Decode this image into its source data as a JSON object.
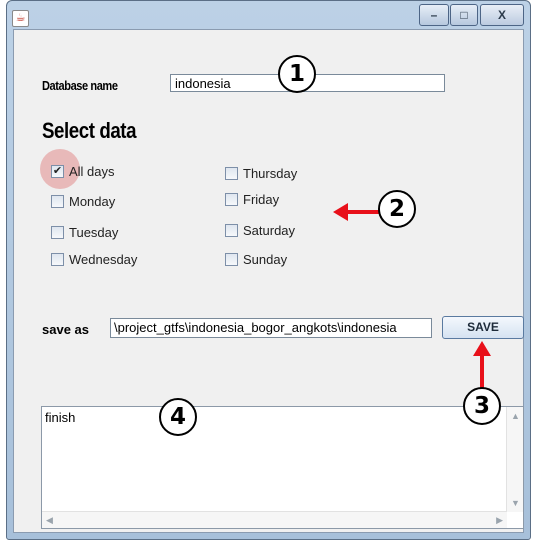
{
  "window": {
    "app_icon": "java-icon",
    "buttons": {
      "minimize": "–",
      "maximize": "□",
      "close": "X"
    }
  },
  "form": {
    "database_label": "Database name",
    "database_value": "indonesia",
    "select_title": "Select data",
    "days": [
      {
        "label": "All days",
        "checked": true
      },
      {
        "label": "Monday",
        "checked": false
      },
      {
        "label": "Tuesday",
        "checked": false
      },
      {
        "label": "Wednesday",
        "checked": false
      },
      {
        "label": "Thursday",
        "checked": false
      },
      {
        "label": "Friday",
        "checked": false
      },
      {
        "label": "Saturday",
        "checked": false
      },
      {
        "label": "Sunday",
        "checked": false
      }
    ],
    "save_label": "save as",
    "save_path": "\\project_gtfs\\indonesia_bogor_angkots\\indonesia",
    "save_button": "SAVE"
  },
  "log": {
    "text": "finish"
  },
  "annotations": {
    "c1": "1",
    "c2": "2",
    "c3": "3",
    "c4": "4"
  },
  "colors": {
    "annotation_arrow": "#e8101a",
    "highlight": "#e18c8c"
  }
}
